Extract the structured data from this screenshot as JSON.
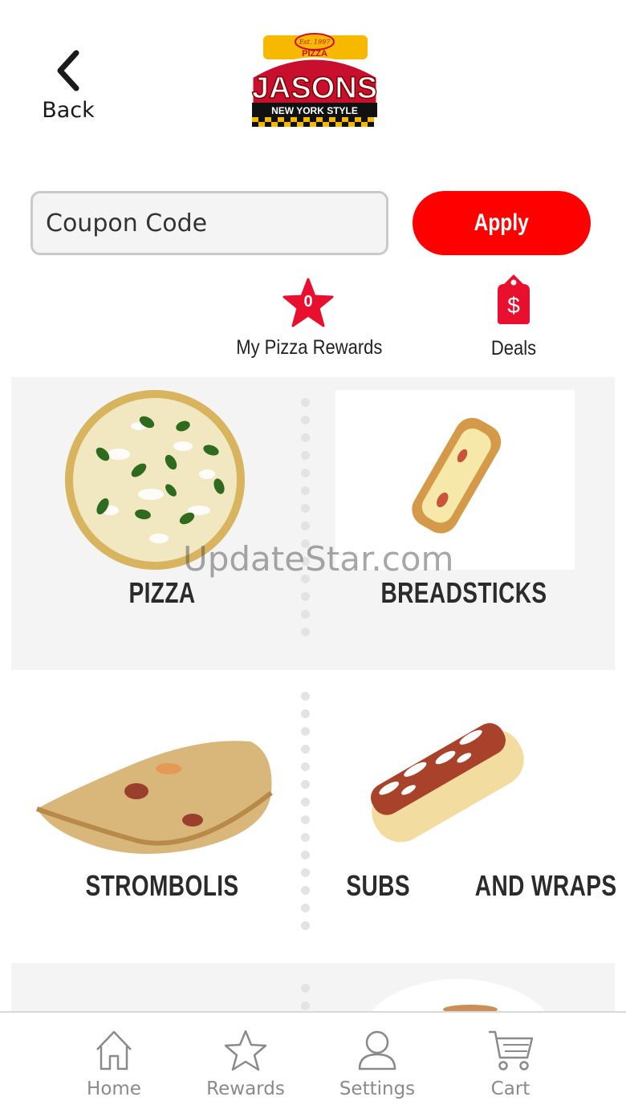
{
  "header": {
    "back_label": "Back",
    "logo": {
      "est": "Est. 1997",
      "small": "PIZZA",
      "brand": "JASONS",
      "tagline": "NEW YORK STYLE"
    }
  },
  "coupon": {
    "placeholder": "Coupon Code",
    "apply_label": "Apply"
  },
  "shortcuts": {
    "rewards": {
      "label": "My Pizza Rewards",
      "count": "0"
    },
    "deals": {
      "label": "Deals"
    }
  },
  "categories": [
    {
      "label": "PIZZA"
    },
    {
      "label": "BREADSTICKS"
    },
    {
      "label": "STROMBOLIS"
    },
    {
      "label": "SUBS          AND WRAPS"
    }
  ],
  "watermark": "UpdateStar.com",
  "nav": {
    "home": "Home",
    "rewards": "Rewards",
    "settings": "Settings",
    "cart": "Cart"
  },
  "colors": {
    "accent": "#ff0000",
    "nav_gray": "#8a8a8a",
    "panel_gray": "#f4f4f4"
  }
}
